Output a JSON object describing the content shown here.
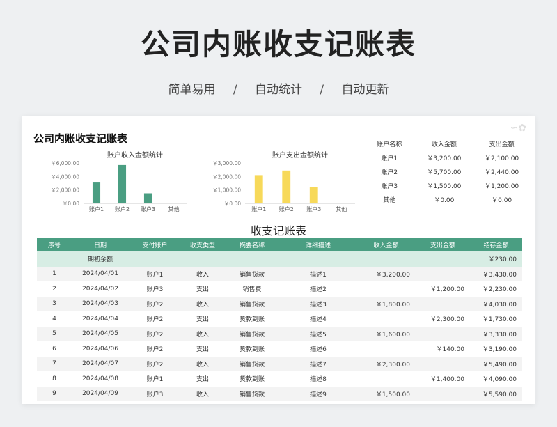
{
  "hero": {
    "title": "公司内账收支记账表",
    "tag1": "简单易用",
    "tag2": "自动统计",
    "tag3": "自动更新",
    "sep": "/"
  },
  "sheet": {
    "title": "公司内账收支记账表"
  },
  "chart_data": [
    {
      "type": "bar",
      "title": "账户收入金额统计",
      "categories": [
        "账户1",
        "账户2",
        "账户3",
        "其他"
      ],
      "values": [
        3200,
        5700,
        1500,
        0
      ],
      "ylim": [
        0,
        6000
      ],
      "yticks": [
        "￥0.00",
        "￥2,000.00",
        "￥4,000.00",
        "￥6,000.00"
      ],
      "ytick_values": [
        0,
        2000,
        4000,
        6000
      ],
      "color": "#4a9e82",
      "grid": false
    },
    {
      "type": "bar",
      "title": "账户支出金额统计",
      "categories": [
        "账户1",
        "账户2",
        "账户3",
        "其他"
      ],
      "values": [
        2100,
        2440,
        1200,
        0
      ],
      "ylim": [
        0,
        3000
      ],
      "yticks": [
        "￥0.00",
        "￥1,000.00",
        "￥2,000.00",
        "￥3,000.00"
      ],
      "ytick_values": [
        0,
        1000,
        2000,
        3000
      ],
      "color": "#f7d95a",
      "grid": false
    }
  ],
  "summary": {
    "headers": [
      "账户名称",
      "收入金额",
      "支出金额"
    ],
    "rows": [
      [
        "账户1",
        "￥3,200.00",
        "￥2,100.00"
      ],
      [
        "账户2",
        "￥5,700.00",
        "￥2,440.00"
      ],
      [
        "账户3",
        "￥1,500.00",
        "￥1,200.00"
      ],
      [
        "其他",
        "￥0.00",
        "￥0.00"
      ]
    ]
  },
  "ledger": {
    "title": "收支记账表",
    "headers": [
      "序号",
      "日期",
      "支付账户",
      "收支类型",
      "摘要名称",
      "详细描述",
      "收入金额",
      "支出金额",
      "结存金额"
    ],
    "opening": {
      "label": "期初余额",
      "balance": "￥230.00"
    },
    "rows": [
      [
        "1",
        "2024/04/01",
        "账户1",
        "收入",
        "销售货款",
        "描述1",
        "￥3,200.00",
        "",
        "￥3,430.00"
      ],
      [
        "2",
        "2024/04/02",
        "账户3",
        "支出",
        "销售费",
        "描述2",
        "",
        "￥1,200.00",
        "￥2,230.00"
      ],
      [
        "3",
        "2024/04/03",
        "账户2",
        "收入",
        "销售货款",
        "描述3",
        "￥1,800.00",
        "",
        "￥4,030.00"
      ],
      [
        "4",
        "2024/04/04",
        "账户2",
        "支出",
        "货款到账",
        "描述4",
        "",
        "￥2,300.00",
        "￥1,730.00"
      ],
      [
        "5",
        "2024/04/05",
        "账户2",
        "收入",
        "销售货款",
        "描述5",
        "￥1,600.00",
        "",
        "￥3,330.00"
      ],
      [
        "6",
        "2024/04/06",
        "账户2",
        "支出",
        "货款到账",
        "描述6",
        "",
        "￥140.00",
        "￥3,190.00"
      ],
      [
        "7",
        "2024/04/07",
        "账户2",
        "收入",
        "销售货款",
        "描述7",
        "￥2,300.00",
        "",
        "￥5,490.00"
      ],
      [
        "8",
        "2024/04/08",
        "账户1",
        "支出",
        "货款到账",
        "描述8",
        "",
        "￥1,400.00",
        "￥4,090.00"
      ],
      [
        "9",
        "2024/04/09",
        "账户3",
        "收入",
        "销售货款",
        "描述9",
        "￥1,500.00",
        "",
        "￥5,590.00"
      ]
    ]
  }
}
